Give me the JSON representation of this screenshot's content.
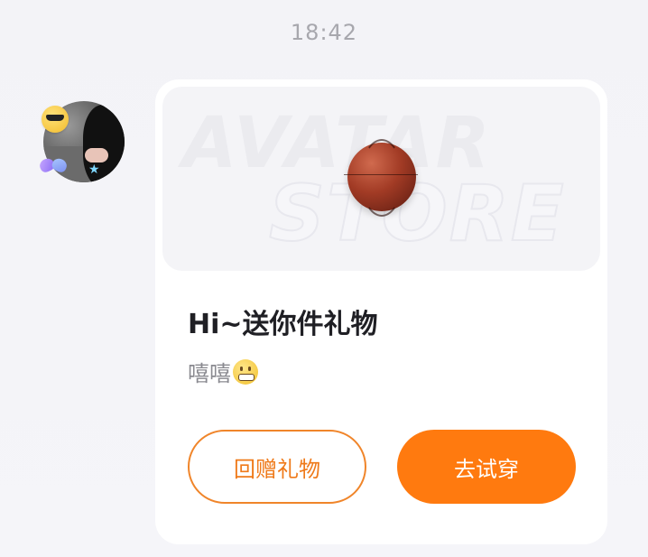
{
  "chat": {
    "timestamp": "18:42"
  },
  "sender": {
    "avatar_icon": "user-avatar",
    "decorations": [
      "sunglasses-emoji-icon",
      "bow-icon",
      "star-icon"
    ]
  },
  "gift_card": {
    "banner_watermark_line1": "AVATAR",
    "banner_watermark_line2": "STORE",
    "gift_item_icon": "basketball-icon",
    "title": "Hi~送你件礼物",
    "message": "嘻嘻",
    "message_emoji": "grimacing-face-emoji",
    "return_gift_button": "回赠礼物",
    "try_on_button": "去试穿"
  },
  "colors": {
    "accent": "#ff7a0f",
    "outline_button_border": "#f0852a",
    "background": "#f4f4f8",
    "card": "#ffffff"
  }
}
